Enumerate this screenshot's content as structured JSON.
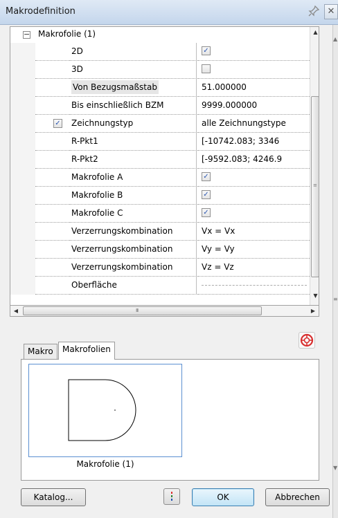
{
  "window": {
    "title": "Makrodefinition",
    "pin_icon": "pin-icon",
    "close_icon": "close-icon"
  },
  "grid": {
    "category": {
      "expander": "−",
      "label": "Makrofolie (1)",
      "expanded": true
    },
    "rows": [
      {
        "name": "2D",
        "type": "checkbox",
        "checked": true
      },
      {
        "name": "3D",
        "type": "checkbox",
        "checked": false
      },
      {
        "name": "Von Bezugsmaßstab",
        "type": "text",
        "value": "51.000000",
        "highlighted": true
      },
      {
        "name": "Bis einschließlich BZM",
        "type": "text",
        "value": "9999.000000"
      },
      {
        "name": "Zeichnungstyp",
        "type": "text",
        "value": "alle Zeichnungstype",
        "row_checkbox": true
      },
      {
        "name": "R-Pkt1",
        "type": "text",
        "value": "[-10742.083; 3346"
      },
      {
        "name": "R-Pkt2",
        "type": "text",
        "value": "[-9592.083; 4246.9"
      },
      {
        "name": "Makrofolie A",
        "type": "checkbox",
        "checked": true
      },
      {
        "name": "Makrofolie B",
        "type": "checkbox",
        "checked": true
      },
      {
        "name": "Makrofolie C",
        "type": "checkbox",
        "checked": true
      },
      {
        "name": "Verzerrungskombination",
        "type": "text",
        "value": "Vx = Vx"
      },
      {
        "name": "Verzerrungskombination",
        "type": "text",
        "value": "Vy = Vy"
      },
      {
        "name": "Verzerrungskombination",
        "type": "text",
        "value": "Vz = Vz"
      },
      {
        "name": "Oberfläche",
        "type": "dashed",
        "value": ""
      }
    ],
    "hscroll_grip": "III"
  },
  "tabs": [
    {
      "label": "Makro",
      "active": false
    },
    {
      "label": "Makrofolien",
      "active": true
    }
  ],
  "preview": {
    "caption": "Makrofolie (1)",
    "target_icon": "target-icon"
  },
  "buttons": {
    "catalog": "Katalog...",
    "ok": "OK",
    "cancel": "Abbrechen",
    "color_icon": "color-bars-icon"
  },
  "colors": {
    "titlebar": "#c4d6ec",
    "selection_border": "#5b8fd1",
    "check": "#2a56b0",
    "target_red": "#d83030"
  }
}
